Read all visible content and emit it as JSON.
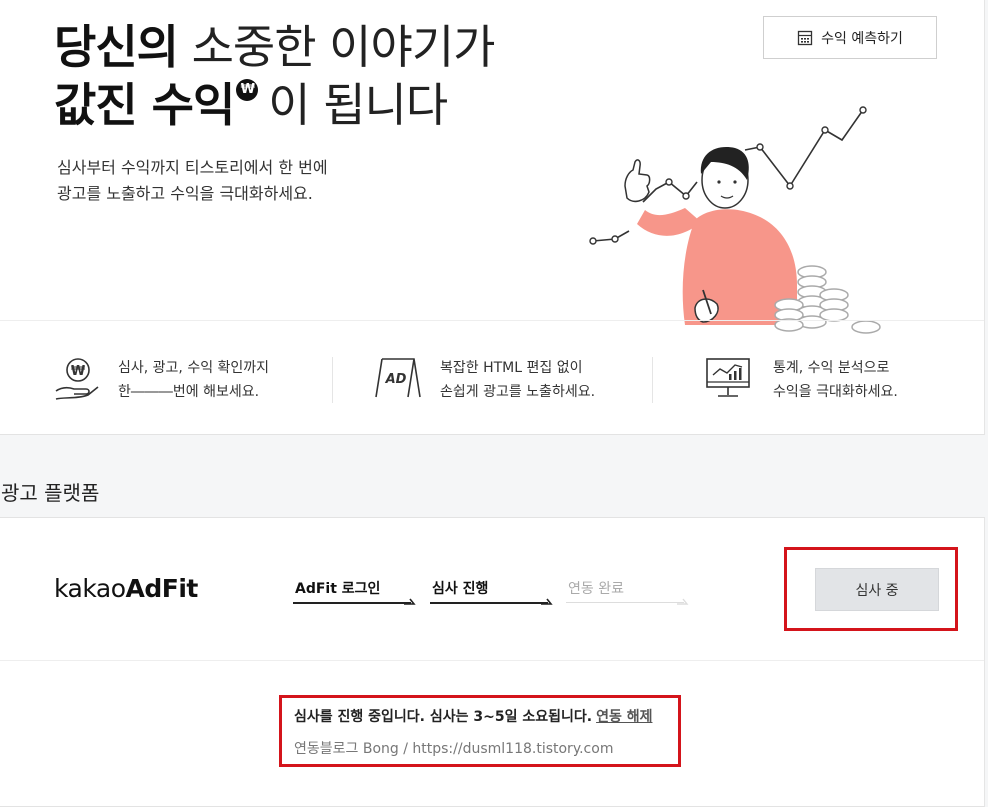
{
  "hero": {
    "title_line1_bold": "당신의",
    "title_line1_rest": " 소중한 이야기가",
    "title_line2_bold": "값진 수익",
    "title_line2_badge": "₩",
    "title_line2_rest": "이 됩니다",
    "desc_line1": "심사부터 수익까지 티스토리에서 한 번에",
    "desc_line2": "광고를 노출하고 수익을 극대화하세요.",
    "predict_button": "수익 예측하기",
    "illustration": "person-with-coins-and-chart"
  },
  "features": [
    {
      "icon": "hand-coin-icon",
      "line1": "심사, 광고, 수익 확인까지",
      "line2": "한―――번에 해보세요."
    },
    {
      "icon": "ad-board-icon",
      "line1": "복잡한 HTML 편집 없이",
      "line2": "손쉽게 광고를 노출하세요."
    },
    {
      "icon": "monitor-chart-icon",
      "line1": "통계, 수익 분석으로",
      "line2": "수익을 극대화하세요."
    }
  ],
  "section": {
    "title": "광고 플랫폼"
  },
  "platform": {
    "logo_light": "kakao",
    "logo_bold": "AdFit",
    "steps": [
      {
        "label": "AdFit 로그인",
        "state": "done"
      },
      {
        "label": "심사 진행",
        "state": "done"
      },
      {
        "label": "연동 완료",
        "state": "pending"
      }
    ],
    "status_button": "심사 중",
    "message": "심사를 진행 중입니다. 심사는 3~5일 소요됩니다.",
    "unlink_label": "연동 해제",
    "blog_line": "연동블로그 Bong / https://dusml118.tistory.com"
  },
  "colors": {
    "highlight": "#d4141b",
    "accent_illustration": "#f7968a"
  }
}
